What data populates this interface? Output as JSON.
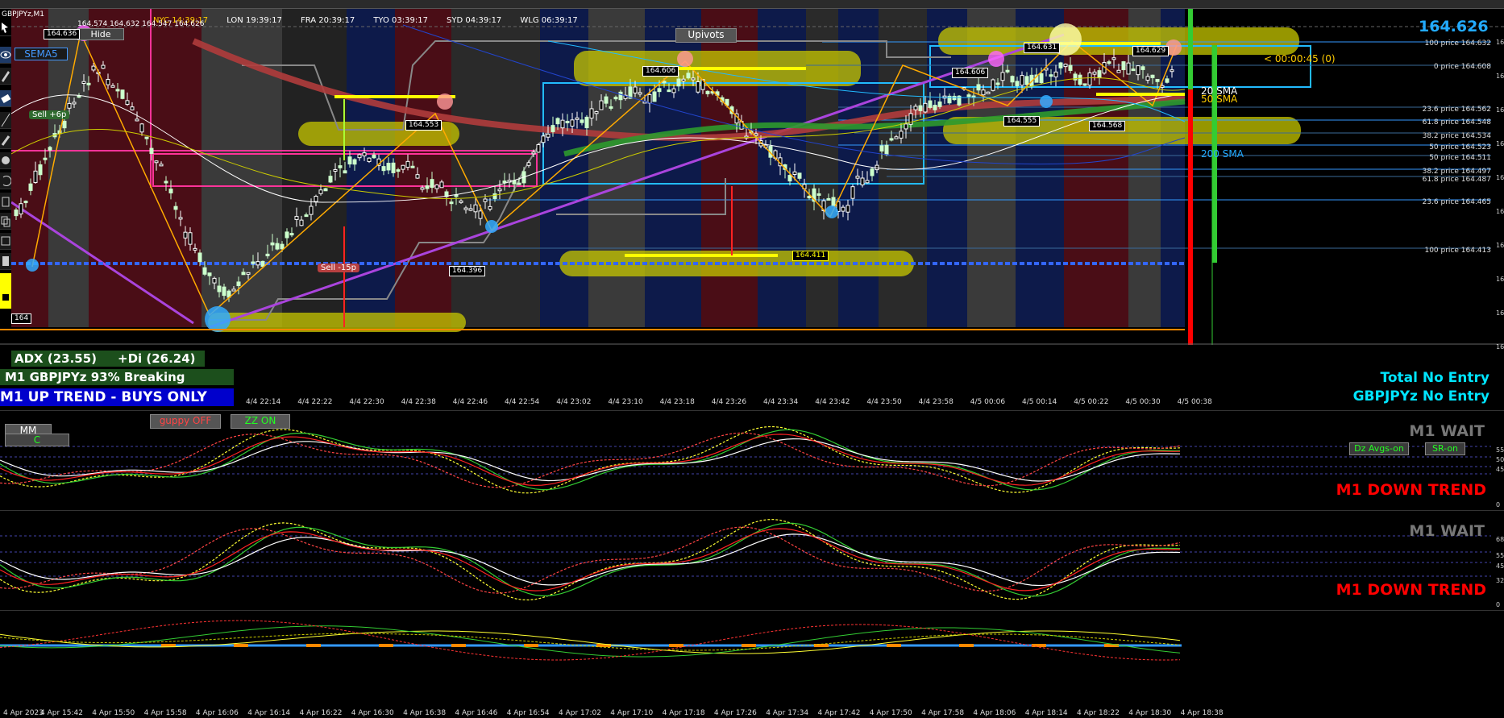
{
  "symbol_label": "GBPJPYz,M1",
  "ohlc_text": "164.574 164.632 164.547 164.626",
  "current_price_big": "164.626",
  "countdown": "< 00:00:45 (0)",
  "sessions": [
    {
      "label": "NYC 14:39:17",
      "color": "#ffcc00"
    },
    {
      "label": "LON 19:39:17",
      "color": "#ffffff"
    },
    {
      "label": "FRA 20:39:17",
      "color": "#ffffff"
    },
    {
      "label": "TYO 03:39:17",
      "color": "#ffffff"
    },
    {
      "label": "SYD 04:39:17",
      "color": "#ffffff"
    },
    {
      "label": "WLG 06:39:17",
      "color": "#ffffff"
    }
  ],
  "buttons": {
    "hide": "Hide",
    "upivots": "Upivots",
    "sema": "SEMA5",
    "guppy": "guppy OFF",
    "zz": "ZZ ON",
    "mm": "MM",
    "c": "C",
    "dz": "Dz Avgs-on",
    "sr": "SR-on"
  },
  "trade_labels": {
    "sell_top": "Sell +6p",
    "sell_mid": "Sell -15p"
  },
  "price_tags": [
    {
      "text": "164.636"
    },
    {
      "text": "164.553"
    },
    {
      "text": "164.606"
    },
    {
      "text": "164.396"
    },
    {
      "text": "164.411"
    },
    {
      "text": "164.606"
    },
    {
      "text": "164.631"
    },
    {
      "text": "164.555"
    },
    {
      "text": "164.568"
    },
    {
      "text": "164.629"
    },
    {
      "text": "164"
    }
  ],
  "fib_levels": [
    {
      "text": "100 price 164.632",
      "color": "#3399ff"
    },
    {
      "text": "0 price 164.608",
      "color": "#3a6a99"
    },
    {
      "text": "23.6 price 164.562",
      "color": "#3a6a99"
    },
    {
      "text": "61.8 price 164.548",
      "color": "#3399ff"
    },
    {
      "text": "38.2 price 164.534",
      "color": "#3a6a99"
    },
    {
      "text": "50 price 164.523",
      "color": "#3399ff"
    },
    {
      "text": "50 price 164.511",
      "color": "#3a6a99"
    },
    {
      "text": "38.2 price 164.497",
      "color": "#3399ff"
    },
    {
      "text": "61.8 price 164.487",
      "color": "#3a6a99"
    },
    {
      "text": "23.6 price 164.465",
      "color": "#3399ff"
    },
    {
      "text": "100 price 164.413",
      "color": "#3a6a99"
    }
  ],
  "sma_labels": {
    "sma20": "20 SMA",
    "sma50": "50 SMA",
    "sma200": "200 SMA"
  },
  "status": {
    "adx": "ADX (23.55)",
    "di": "+Di (26.24)",
    "breaking": "M1 GBPJPYz 93% Breaking",
    "trend_main": "M1 UP TREND - BUYS ONLY",
    "total_no_entry": "Total No Entry",
    "symbol_no_entry": "GBPJPYz No Entry"
  },
  "main_time_axis": [
    "4/4 22:14",
    "4/4 22:22",
    "4/4 22:30",
    "4/4 22:38",
    "4/4 22:46",
    "4/4 22:54",
    "4/4 23:02",
    "4/4 23:10",
    "4/4 23:18",
    "4/4 23:26",
    "4/4 23:34",
    "4/4 23:42",
    "4/4 23:50",
    "4/4 23:58",
    "4/5 00:06",
    "4/5 00:14",
    "4/5 00:22",
    "4/5 00:30",
    "4/5 00:38"
  ],
  "bottom_time_axis": [
    "4 Apr 2023",
    "4 Apr 15:42",
    "4 Apr 15:50",
    "4 Apr 15:58",
    "4 Apr 16:06",
    "4 Apr 16:14",
    "4 Apr 16:22",
    "4 Apr 16:30",
    "4 Apr 16:38",
    "4 Apr 16:46",
    "4 Apr 16:54",
    "4 Apr 17:02",
    "4 Apr 17:10",
    "4 Apr 17:18",
    "4 Apr 17:26",
    "4 Apr 17:34",
    "4 Apr 17:42",
    "4 Apr 17:50",
    "4 Apr 17:58",
    "4 Apr 18:06",
    "4 Apr 18:14",
    "4 Apr 18:22",
    "4 Apr 18:30",
    "4 Apr 18:38"
  ],
  "panels": {
    "p1": {
      "wait": "M1 WAIT",
      "trend": "M1 DOWN TREND",
      "scale": [
        "55",
        "50",
        "45",
        "0"
      ]
    },
    "p2": {
      "wait": "M1 WAIT",
      "trend": "M1 DOWN TREND",
      "scale": [
        "68",
        "55",
        "45",
        "32",
        "0"
      ]
    }
  },
  "right_axis_labels": [
    "16",
    "16",
    "16",
    "16",
    "16",
    "16",
    "16",
    "16",
    "16",
    "16"
  ],
  "colors": {
    "bull": "#ccffcc",
    "bear": "#ffffff",
    "highlight": "#c8c800",
    "magenta": "#ff3399",
    "purple": "#aa44dd",
    "cyan": "#22bbff",
    "trend_red": "#ff0000",
    "trend_cyan": "#00e5ff"
  }
}
